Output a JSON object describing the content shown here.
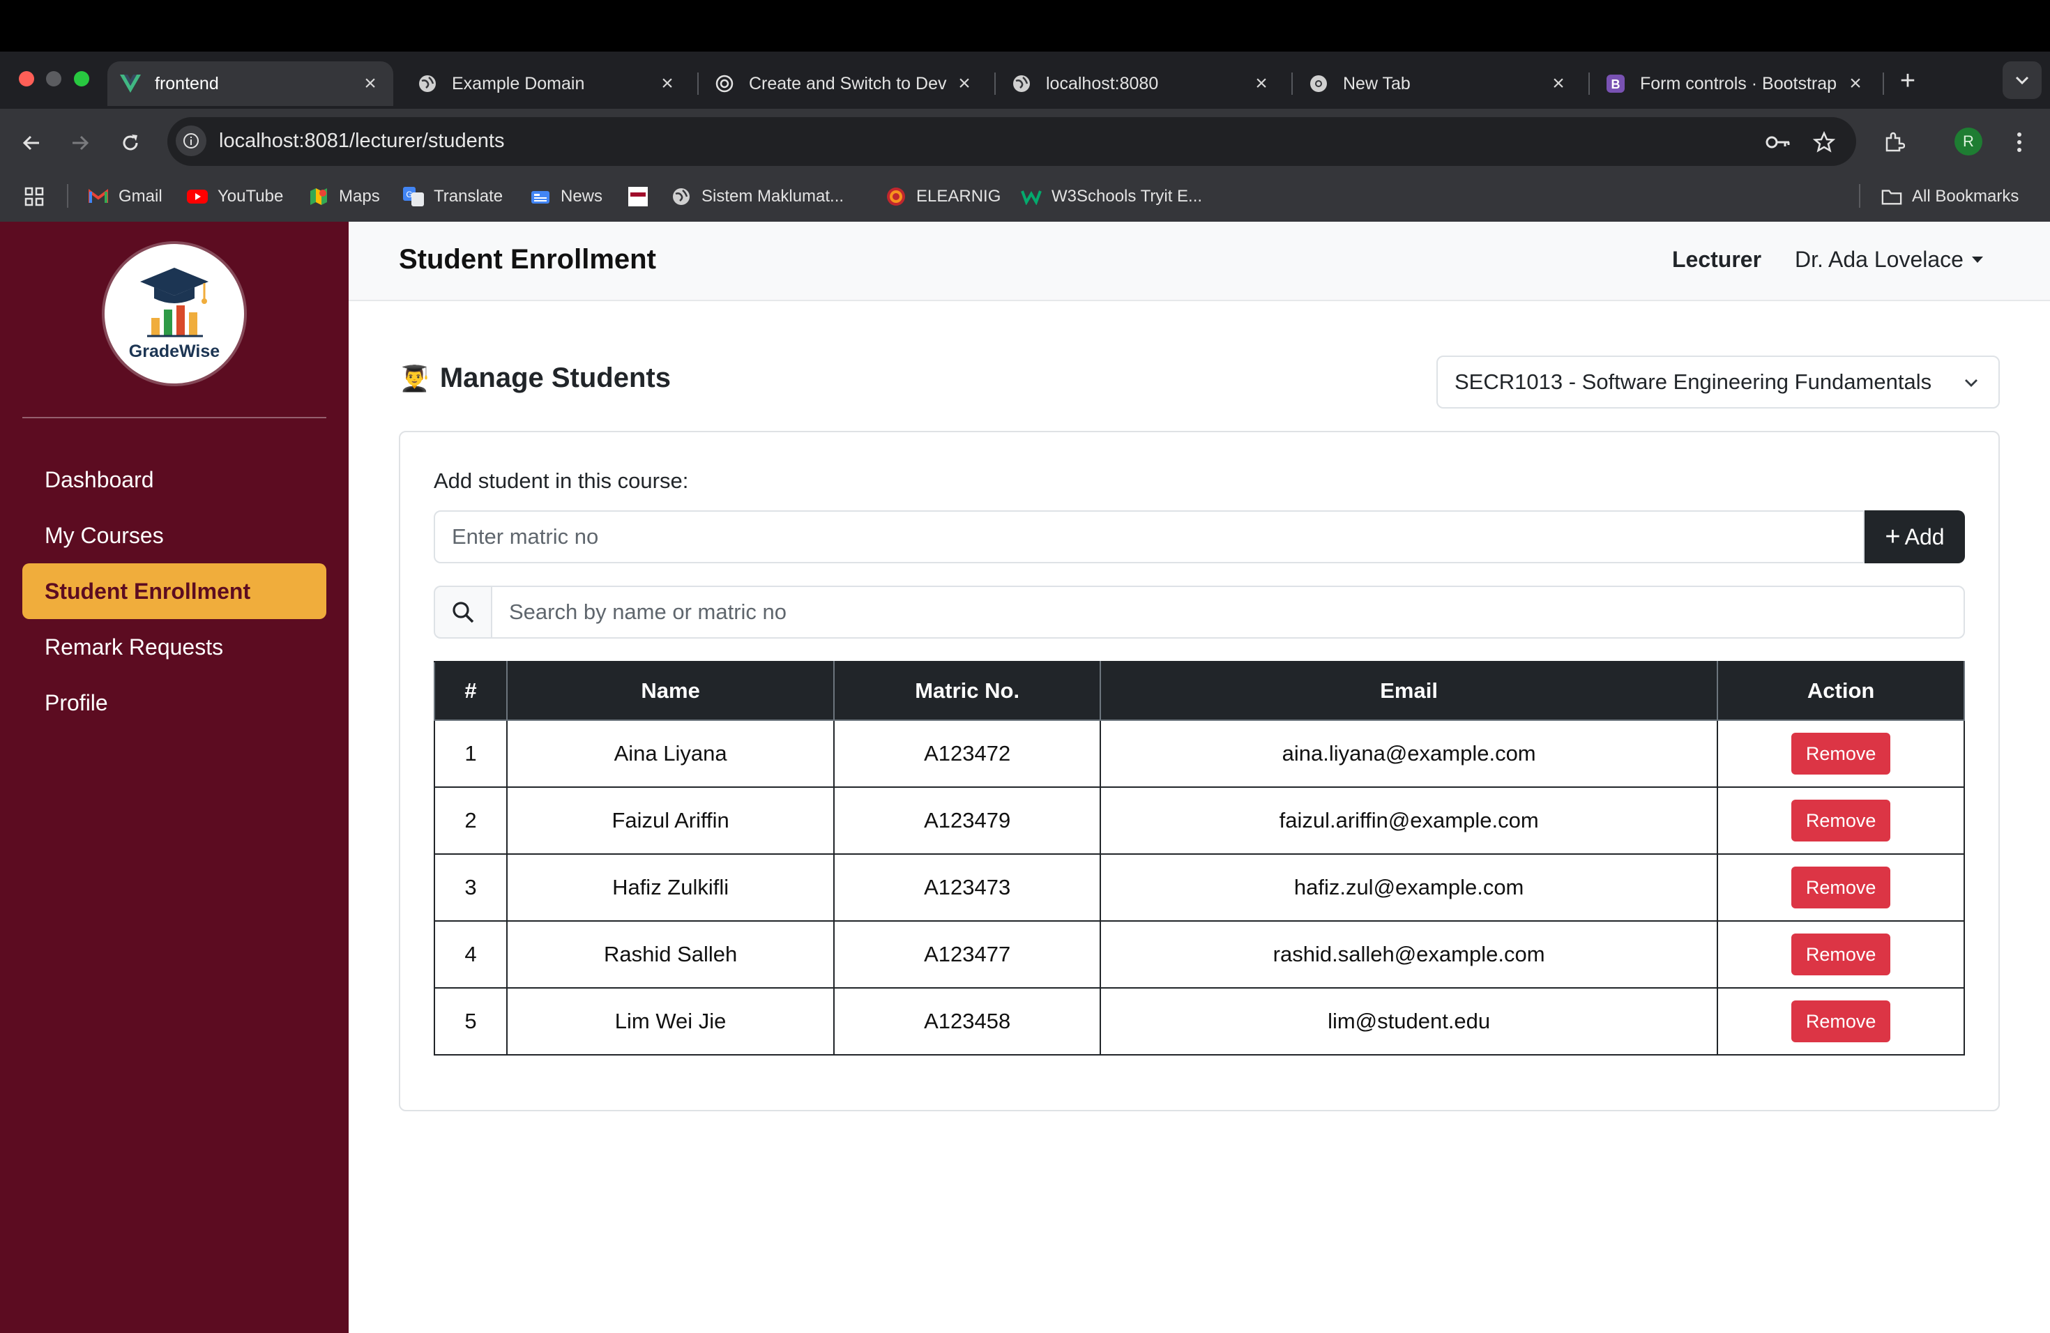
{
  "browser": {
    "tabs": [
      {
        "title": "frontend",
        "icon": "vue-icon",
        "active": true
      },
      {
        "title": "Example Domain",
        "icon": "globe-icon",
        "active": false
      },
      {
        "title": "Create and Switch to Dev",
        "icon": "openai-icon",
        "active": false
      },
      {
        "title": "localhost:8080",
        "icon": "globe-icon",
        "active": false
      },
      {
        "title": "New Tab",
        "icon": "chrome-icon",
        "active": false
      },
      {
        "title": "Form controls · Bootstrap",
        "icon": "bootstrap-icon",
        "active": false
      }
    ],
    "url": "localhost:8081/lecturer/students",
    "profile_initial": "R",
    "bookmarks": [
      {
        "label": "Gmail",
        "icon": "gmail-icon"
      },
      {
        "label": "YouTube",
        "icon": "youtube-icon"
      },
      {
        "label": "Maps",
        "icon": "maps-icon"
      },
      {
        "label": "Translate",
        "icon": "translate-icon"
      },
      {
        "label": "News",
        "icon": "news-icon"
      },
      {
        "label": "",
        "icon": "utm-icon"
      },
      {
        "label": "Sistem Maklumat...",
        "icon": "globe-icon"
      },
      {
        "label": "ELEARNIG",
        "icon": "elearning-icon"
      },
      {
        "label": "W3Schools Tryit E...",
        "icon": "w3schools-icon"
      }
    ],
    "all_bookmarks": "All Bookmarks"
  },
  "sidebar": {
    "logo_text": "GradeWise",
    "items": [
      {
        "label": "Dashboard",
        "active": false
      },
      {
        "label": "My Courses",
        "active": false
      },
      {
        "label": "Student Enrollment",
        "active": true
      },
      {
        "label": "Remark Requests",
        "active": false
      },
      {
        "label": "Profile",
        "active": false
      }
    ]
  },
  "header": {
    "title": "Student Enrollment",
    "role": "Lecturer",
    "user": "Dr. Ada Lovelace"
  },
  "main": {
    "emoji": "👨‍🎓",
    "title": "Manage Students",
    "course_selected": "SECR1013 - Software Engineering Fundamentals",
    "add_label": "Add student in this course:",
    "matric_placeholder": "Enter matric no",
    "add_button": "Add",
    "search_placeholder": "Search by name or matric no"
  },
  "table": {
    "headers": [
      "#",
      "Name",
      "Matric No.",
      "Email",
      "Action"
    ],
    "rows": [
      {
        "no": "1",
        "name": "Aina Liyana",
        "matric": "A123472",
        "email": "aina.liyana@example.com",
        "action": "Remove"
      },
      {
        "no": "2",
        "name": "Faizul Ariffin",
        "matric": "A123479",
        "email": "faizul.ariffin@example.com",
        "action": "Remove"
      },
      {
        "no": "3",
        "name": "Hafiz Zulkifli",
        "matric": "A123473",
        "email": "hafiz.zul@example.com",
        "action": "Remove"
      },
      {
        "no": "4",
        "name": "Rashid Salleh",
        "matric": "A123477",
        "email": "rashid.salleh@example.com",
        "action": "Remove"
      },
      {
        "no": "5",
        "name": "Lim Wei Jie",
        "matric": "A123458",
        "email": "lim@student.edu",
        "action": "Remove"
      }
    ]
  },
  "colors": {
    "sidebar_bg": "#5c0c21",
    "active_nav": "#f0ad3c",
    "danger": "#dc3545",
    "dark": "#212529"
  }
}
